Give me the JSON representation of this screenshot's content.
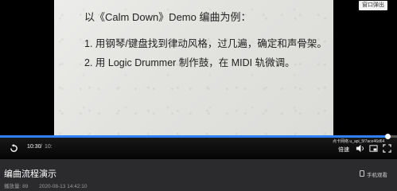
{
  "slide": {
    "title": "以《Calm Down》Demo 编曲为例：",
    "line1": "1. 用钢琴/键盘找到律动风格，过几遍，确定和声骨架。",
    "line2": "2. 用 Logic Drummer 制作鼓，在 MIDI 轨微调。"
  },
  "player": {
    "popout_label": "窗口弹出",
    "time_current": "10:30",
    "time_separator": "/",
    "time_total": "10:",
    "watermark": "点卡网络 u_api_5f7ace46d64",
    "quality_label": "倍速",
    "progress": 0.975,
    "icons": {
      "replay": "replay-icon",
      "volume": "volume-icon",
      "pip": "picture-in-picture-icon",
      "fullscreen": "fullscreen-icon",
      "phone": "phone-icon"
    }
  },
  "video": {
    "title": "编曲流程演示",
    "plays": "播放量: 89",
    "date": "2020-08-13 14:42:10",
    "watch_on_phone": "手机观看"
  },
  "colors": {
    "accent": "#2f80ff"
  }
}
